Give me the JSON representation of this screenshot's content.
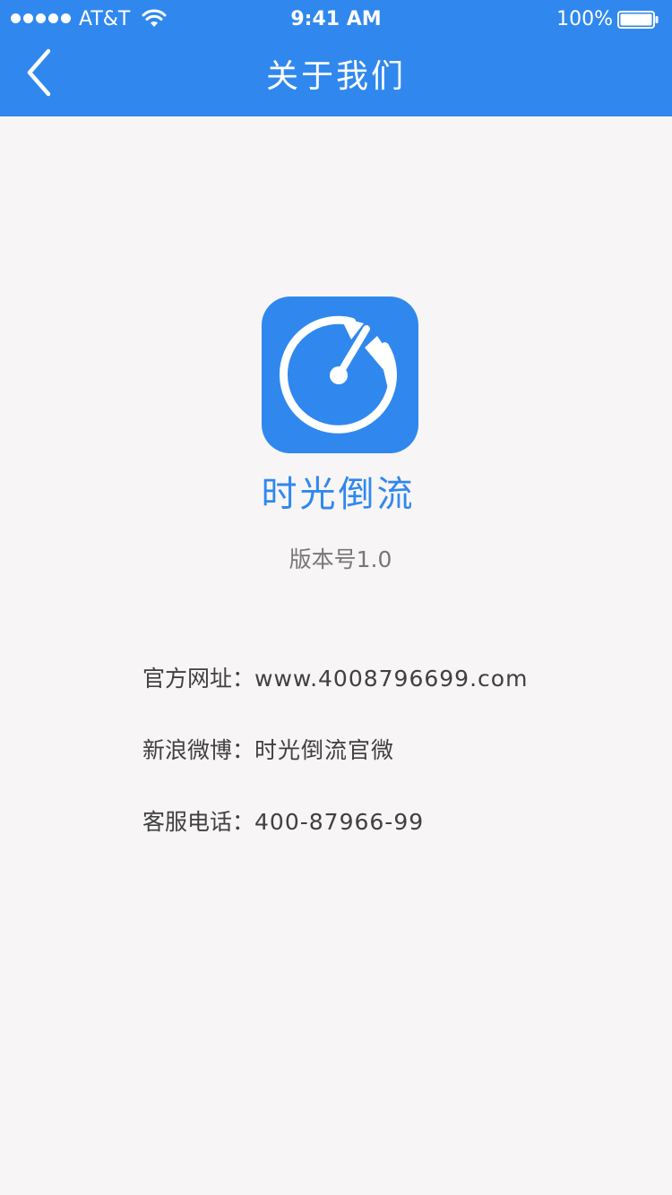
{
  "status_bar": {
    "carrier": "AT&T",
    "time": "9:41 AM",
    "battery_percent": "100%",
    "signal_bars": 5,
    "battery_level": 1.0
  },
  "nav": {
    "title": "关于我们",
    "back_icon": "chevron-left-icon"
  },
  "app": {
    "icon": "stopwatch-icon",
    "name": "时光倒流",
    "version": "版本号1.0"
  },
  "info": {
    "separator": "：",
    "website": {
      "label": "官方网址",
      "value": "www.4008796699.com"
    },
    "weibo": {
      "label": "新浪微博",
      "value": "时光倒流官微"
    },
    "phone": {
      "label": "客服电话",
      "value": "400-87966-99"
    }
  },
  "colors": {
    "brand": "#3088ee",
    "background": "#f7f5f5",
    "text": "#404040",
    "muted": "#777777"
  }
}
